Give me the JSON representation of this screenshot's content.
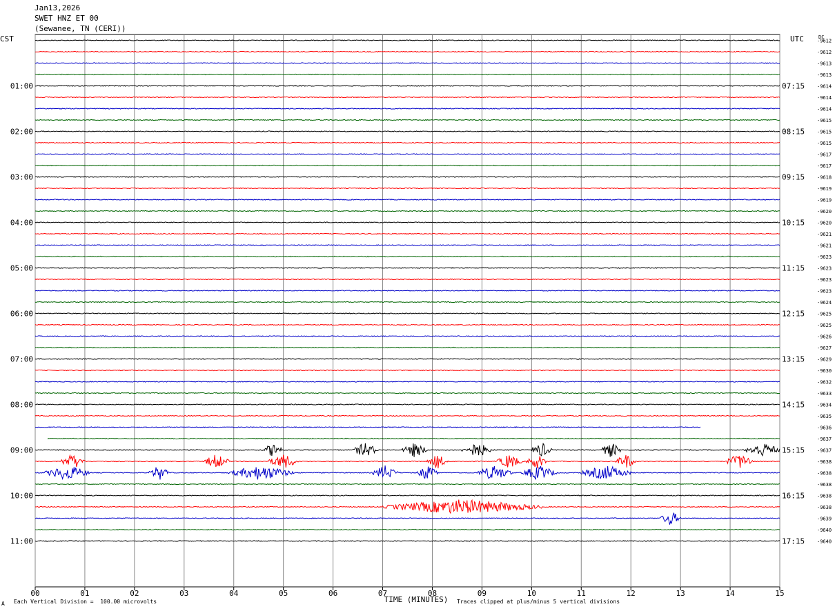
{
  "header": {
    "date": "Jan13,2026",
    "station": "SWET HNZ ET 00",
    "location": "(Sewanee, TN (CERI))"
  },
  "chart_data": {
    "type": "line",
    "title": "SWET HNZ ET 00",
    "left_axis_label": "CST",
    "right_axis_label": "UTC",
    "dc_label": "DC",
    "xlabel": "TIME (MINUTES)",
    "x_ticks": [
      "00",
      "01",
      "02",
      "03",
      "04",
      "05",
      "06",
      "07",
      "08",
      "09",
      "10",
      "11",
      "12",
      "13",
      "14",
      "15"
    ],
    "xlim": [
      0,
      15
    ],
    "grid": true,
    "left_hour_labels": [
      "01:00",
      "02:00",
      "03:00",
      "04:00",
      "05:00",
      "06:00",
      "07:00",
      "08:00",
      "09:00",
      "10:00",
      "11:00"
    ],
    "right_hour_labels": [
      "07:15",
      "08:15",
      "09:15",
      "10:15",
      "11:15",
      "12:15",
      "13:15",
      "14:15",
      "15:15",
      "16:15",
      "17:15"
    ],
    "trace_colors": [
      "#000000",
      "#ff0000",
      "#0000c8",
      "#006400"
    ],
    "dc_offsets": [
      -9612,
      -9612,
      -9613,
      -9613,
      -9614,
      -9614,
      -9614,
      -9615,
      -9615,
      -9615,
      -9617,
      -9617,
      -9618,
      -9619,
      -9619,
      -9620,
      -9620,
      -9621,
      -9621,
      -9623,
      -9623,
      -9623,
      -9623,
      -9624,
      -9625,
      -9625,
      -9626,
      -9627,
      -9629,
      -9630,
      -9632,
      -9633,
      -9634,
      -9635,
      -9636,
      -9637,
      -9637,
      -9638,
      -9638,
      -9638,
      -9638,
      -9638,
      -9639,
      -9640,
      -9640
    ],
    "trace_activity": [
      {
        "trace": 34,
        "end_minute": 13.4
      },
      {
        "trace": 35,
        "start_minute": 0.25
      },
      {
        "trace": 36,
        "events": [
          [
            4.6,
            5.0
          ],
          [
            6.4,
            6.9
          ],
          [
            7.4,
            7.9
          ],
          [
            8.6,
            9.2
          ],
          [
            10.0,
            10.4
          ],
          [
            11.4,
            11.8
          ],
          [
            14.3,
            15.0
          ]
        ]
      },
      {
        "trace": 37,
        "events": [
          [
            0.5,
            1.0
          ],
          [
            3.4,
            3.9
          ],
          [
            4.7,
            5.3
          ],
          [
            7.9,
            8.3
          ],
          [
            9.3,
            9.8
          ],
          [
            9.9,
            10.3
          ],
          [
            11.7,
            12.1
          ],
          [
            13.9,
            14.5
          ]
        ]
      },
      {
        "trace": 38,
        "events": [
          [
            0.2,
            1.1
          ],
          [
            2.3,
            2.7
          ],
          [
            3.9,
            5.2
          ],
          [
            6.8,
            7.3
          ],
          [
            7.7,
            8.1
          ],
          [
            8.9,
            9.6
          ],
          [
            9.8,
            10.5
          ],
          [
            11.0,
            12.0
          ]
        ]
      },
      {
        "trace": 41,
        "events": [
          [
            7.0,
            10.2
          ]
        ]
      },
      {
        "trace": 42,
        "events": [
          [
            12.6,
            13.0
          ]
        ]
      }
    ]
  },
  "footer": {
    "vertical_division": "Each Vertical Division =  100.00 microvolts",
    "clip_note": "Traces clipped at plus/minus 5 vertical divisions",
    "corner_mark": "A"
  }
}
